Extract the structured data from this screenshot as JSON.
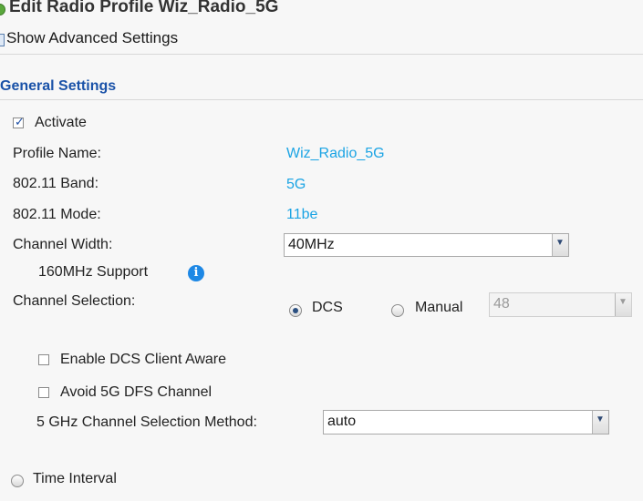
{
  "header": {
    "title": "Edit Radio Profile Wiz_Radio_5G"
  },
  "toolbar": {
    "advanced_label": "Show Advanced Settings"
  },
  "section": {
    "title": "General Settings"
  },
  "form": {
    "activate_label": "Activate",
    "activate_checked": true,
    "profile_name_label": "Profile Name:",
    "profile_name_value": "Wiz_Radio_5G",
    "band_label": "802.11 Band:",
    "band_value": "5G",
    "mode_label": "802.11 Mode:",
    "mode_value": "11be",
    "channel_width_label": "Channel Width:",
    "channel_width_value": "40MHz",
    "support_160_label": "160MHz Support",
    "channel_selection_label": "Channel Selection:",
    "dcs_label": "DCS",
    "manual_label": "Manual",
    "manual_channel_value": "48",
    "dcs_client_aware_label": "Enable DCS Client Aware",
    "avoid_dfs_label": "Avoid 5G DFS Channel",
    "method_label": "5 GHz Channel Selection Method:",
    "method_value": "auto",
    "time_interval_label": "Time Interval"
  },
  "icons": {
    "info": "i",
    "dropdown": "▼"
  },
  "colors": {
    "section_title": "#1a52a8",
    "value_text": "#1ba4e4",
    "info_icon": "#1e88e5"
  }
}
